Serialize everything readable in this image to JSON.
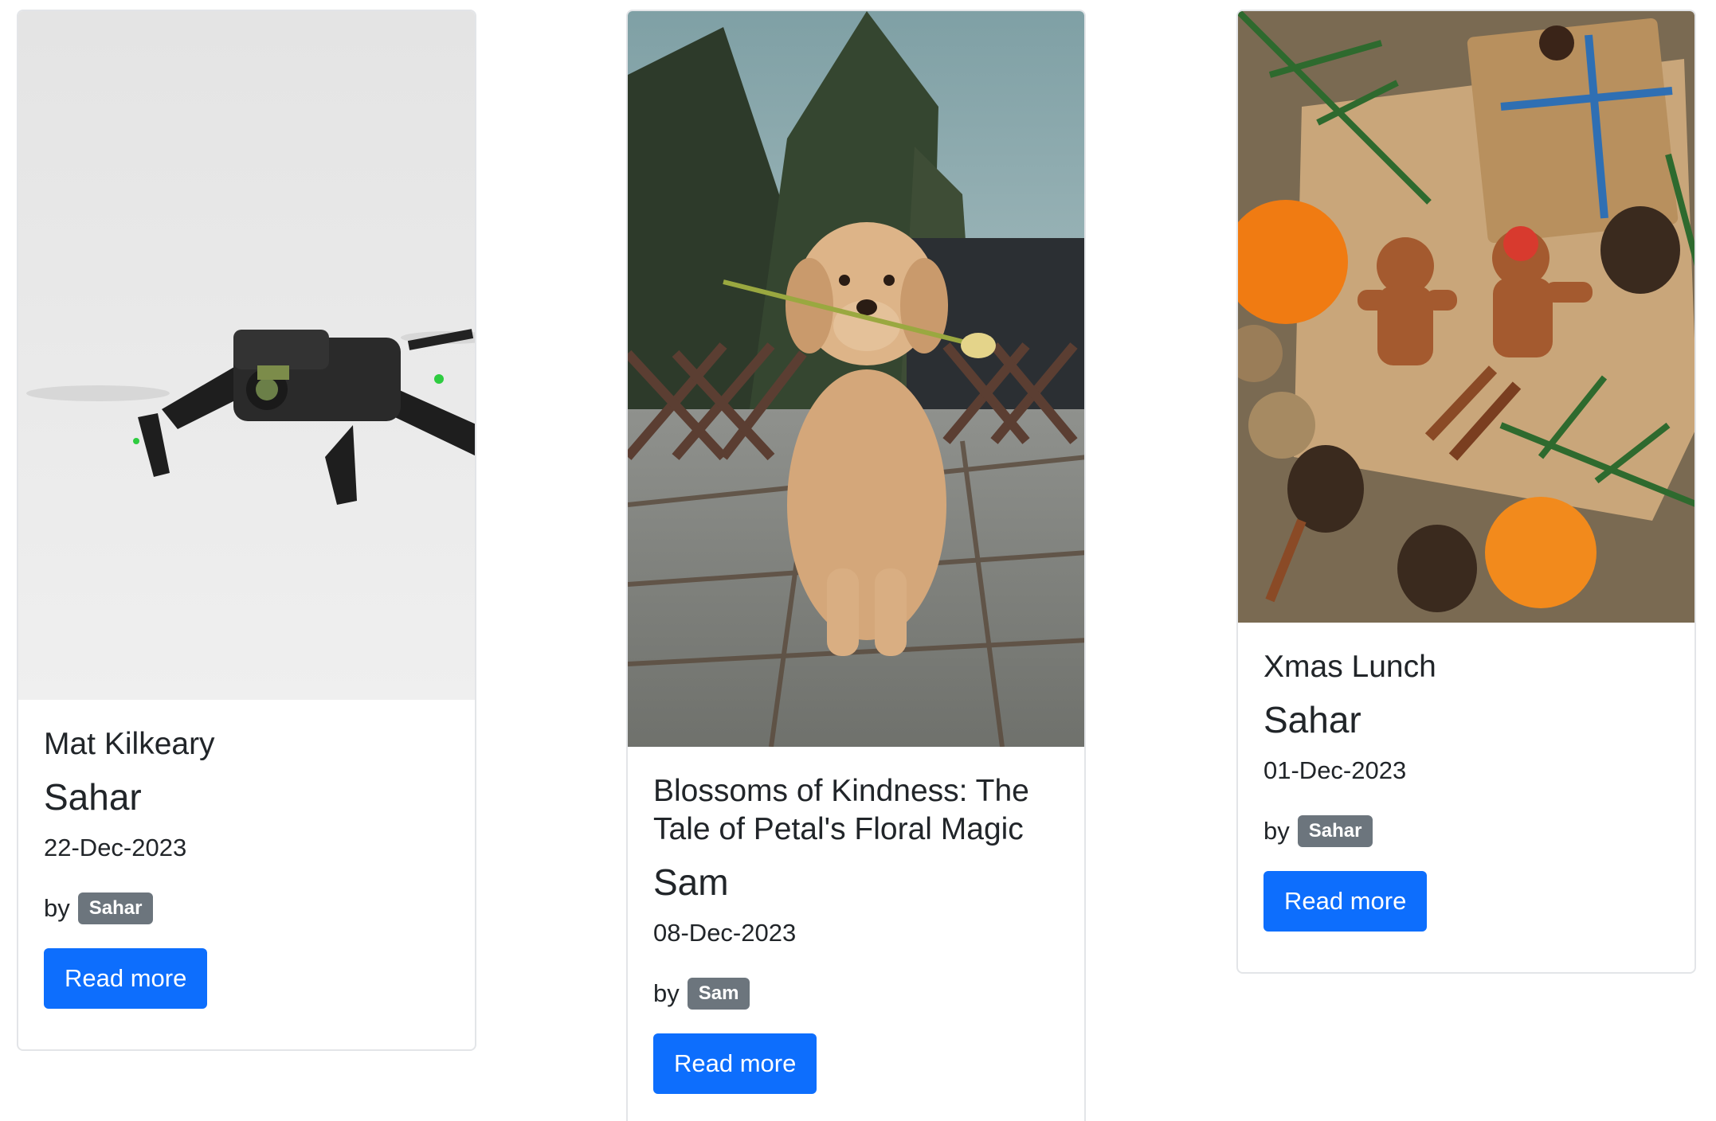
{
  "cards": [
    {
      "image_alt": "drone-photo",
      "title": "Mat Kilkeary",
      "subtitle": "Sahar",
      "date": "22-Dec-2023",
      "by_label": "by",
      "author": "Sahar",
      "button_label": "Read more"
    },
    {
      "image_alt": "dog-with-flower-photo",
      "title": "Blossoms of Kindness: The Tale of Petal's Floral Magic",
      "subtitle": "Sam",
      "date": "08-Dec-2023",
      "by_label": "by",
      "author": "Sam",
      "button_label": "Read more"
    },
    {
      "image_alt": "christmas-cookies-photo",
      "title": "Xmas Lunch",
      "subtitle": "Sahar",
      "date": "01-Dec-2023",
      "by_label": "by",
      "author": "Sahar",
      "button_label": "Read more"
    }
  ],
  "colors": {
    "primary_button": "#0d6efd",
    "badge": "#6c757d",
    "card_border": "#e3e5e8"
  }
}
